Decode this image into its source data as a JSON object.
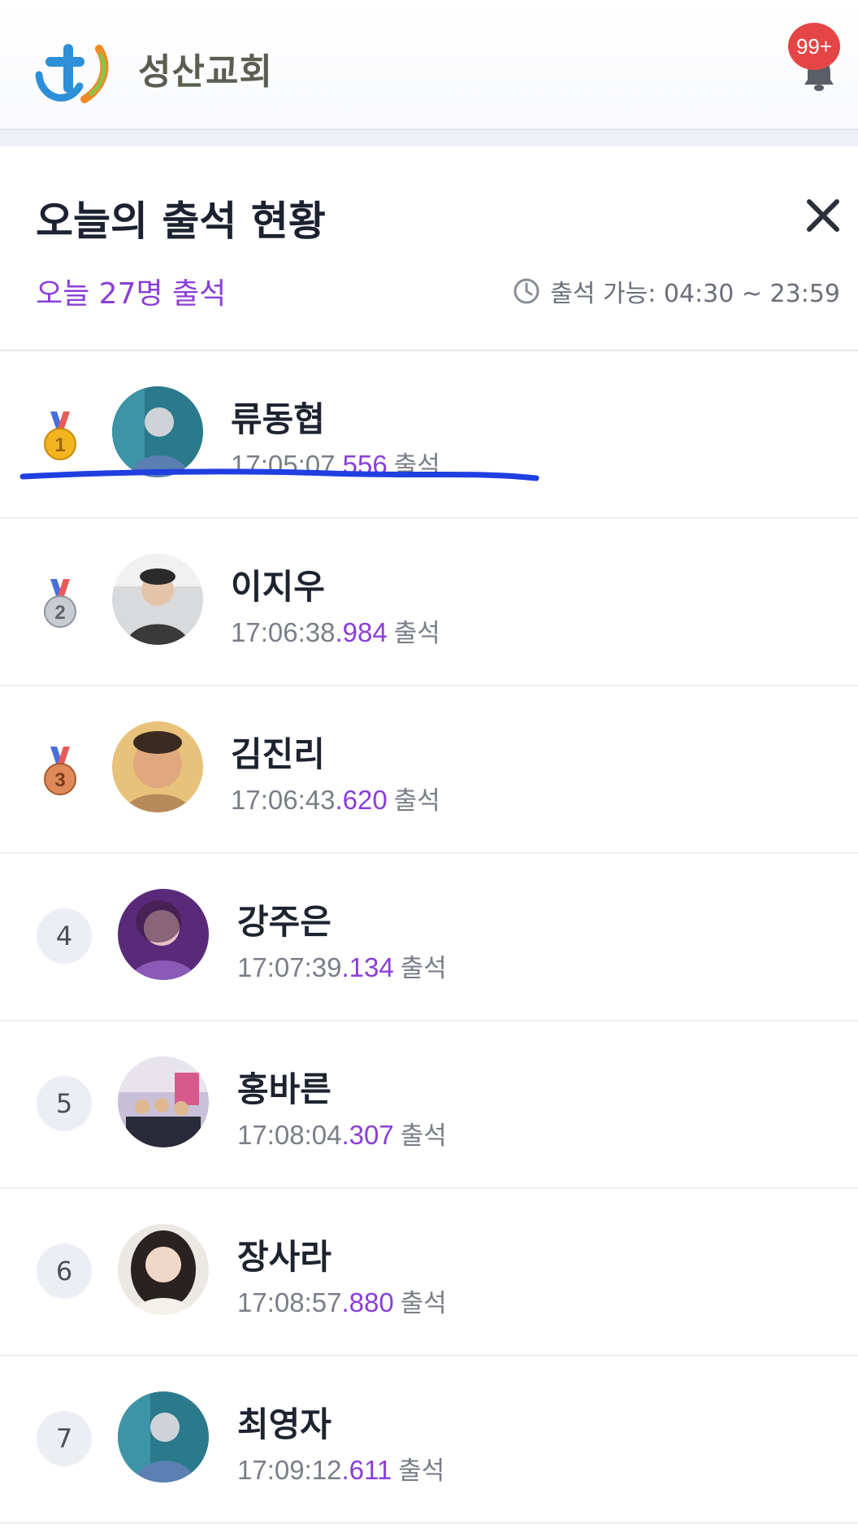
{
  "header": {
    "brand_name": "성산교회",
    "notification_badge": "99+",
    "colors": {
      "logo_blue": "#2d8fd8",
      "logo_orange": "#f08a24",
      "logo_green": "#8bc34a",
      "badge": "#e64545"
    }
  },
  "panel": {
    "title": "오늘의 출석 현황",
    "today_count": "오늘 27명 출석",
    "window_info": "출석 가능: 04:30 ~ 23:59",
    "accent_color": "#8a3fd6"
  },
  "attendees": [
    {
      "rank": "1",
      "badge": "gold-medal",
      "name": "류동협",
      "time_main": "17:05:07",
      "time_ms": ".556",
      "suffix": "출석"
    },
    {
      "rank": "2",
      "badge": "silver-medal",
      "name": "이지우",
      "time_main": "17:06:38",
      "time_ms": ".984",
      "suffix": "출석"
    },
    {
      "rank": "3",
      "badge": "bronze-medal",
      "name": "김진리",
      "time_main": "17:06:43",
      "time_ms": ".620",
      "suffix": "출석"
    },
    {
      "rank": "4",
      "badge": "number",
      "name": "강주은",
      "time_main": "17:07:39",
      "time_ms": ".134",
      "suffix": "출석"
    },
    {
      "rank": "5",
      "badge": "number",
      "name": "홍바른",
      "time_main": "17:08:04",
      "time_ms": ".307",
      "suffix": "출석"
    },
    {
      "rank": "6",
      "badge": "number",
      "name": "장사라",
      "time_main": "17:08:57",
      "time_ms": ".880",
      "suffix": "출석"
    },
    {
      "rank": "7",
      "badge": "number",
      "name": "최영자",
      "time_main": "17:09:12",
      "time_ms": ".611",
      "suffix": "출석"
    }
  ]
}
